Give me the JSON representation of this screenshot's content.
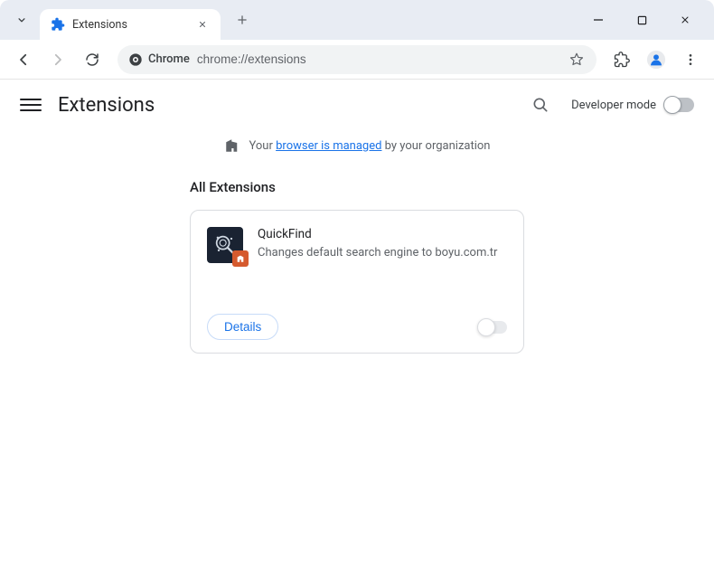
{
  "tab": {
    "title": "Extensions"
  },
  "omnibox": {
    "brand": "Chrome",
    "url": "chrome://extensions"
  },
  "header": {
    "page_title": "Extensions",
    "dev_mode_label": "Developer mode"
  },
  "notice": {
    "prefix": "Your ",
    "link": "browser is managed",
    "suffix": " by your organization"
  },
  "section": {
    "title": "All Extensions"
  },
  "extension": {
    "name": "QuickFind",
    "description": "Changes default search engine to boyu.com.tr",
    "details_label": "Details"
  }
}
